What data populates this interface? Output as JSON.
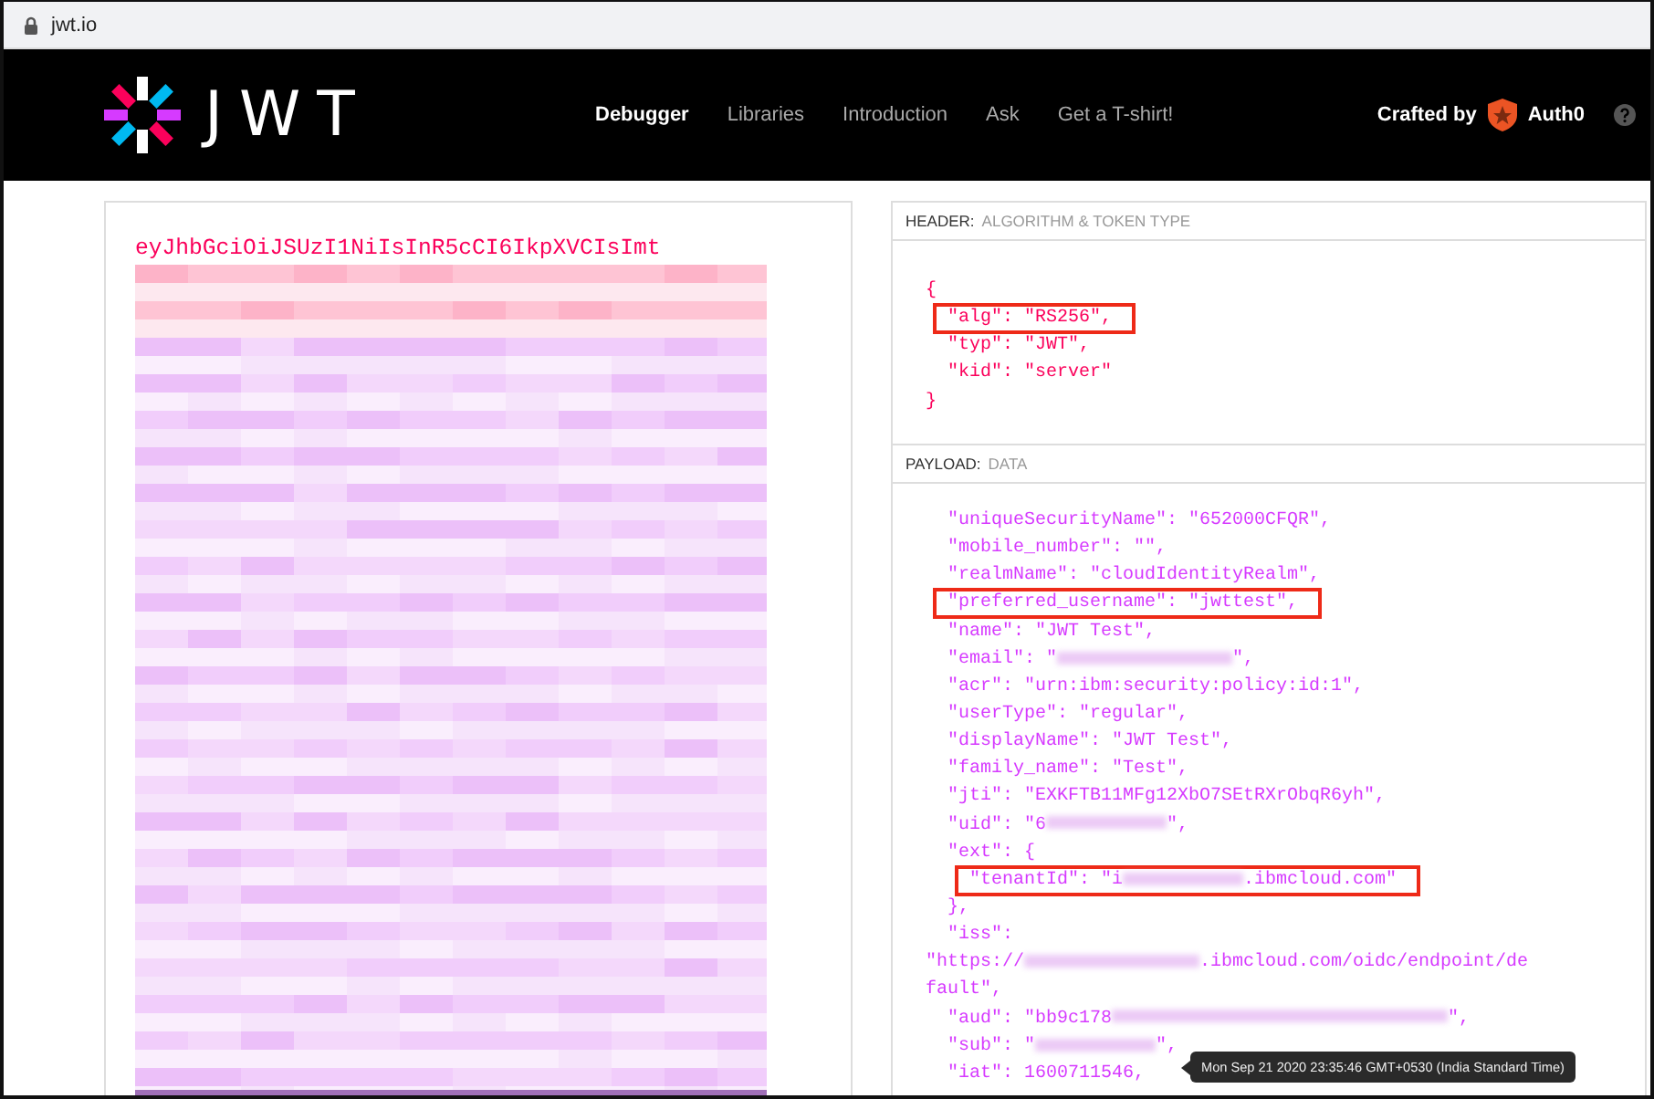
{
  "browser": {
    "url": "jwt.io"
  },
  "nav": {
    "logo_text": "JWT",
    "items": [
      {
        "label": "Debugger",
        "selected": true
      },
      {
        "label": "Libraries",
        "selected": false
      },
      {
        "label": "Introduction",
        "selected": false
      },
      {
        "label": "Ask",
        "selected": false
      },
      {
        "label": "Get a T-shirt!",
        "selected": false
      }
    ],
    "crafted_by": "Crafted by",
    "brand": "Auth0"
  },
  "encoded": {
    "token_start": "eyJhbGciOiJSUzI1NiIsInR5cCI6IkpXVCIsImt"
  },
  "header": {
    "title": "HEADER:",
    "subtitle": "ALGORITHM & TOKEN TYPE",
    "lines": [
      {
        "highlighted": false,
        "segments": [
          {
            "kind": "text",
            "text": "{"
          }
        ],
        "children": [
          {
            "highlighted": true,
            "segments": [
              {
                "kind": "text",
                "text": "\"alg\": \"RS256\","
              }
            ]
          },
          {
            "highlighted": false,
            "segments": [
              {
                "kind": "text",
                "text": "\"typ\": \"JWT\","
              }
            ]
          },
          {
            "highlighted": false,
            "segments": [
              {
                "kind": "text",
                "text": "\"kid\": \"server\""
              }
            ]
          }
        ]
      },
      {
        "highlighted": false,
        "segments": [
          {
            "kind": "text",
            "text": "}"
          }
        ]
      }
    ]
  },
  "payload": {
    "title": "PAYLOAD:",
    "subtitle": "DATA",
    "lines": [
      {
        "highlighted": false,
        "segments": [
          {
            "kind": "text",
            "text": "\"uniqueSecurityName\": \"652000CFQR\","
          }
        ]
      },
      {
        "highlighted": false,
        "segments": [
          {
            "kind": "text",
            "text": "\"mobile_number\": \"\","
          }
        ]
      },
      {
        "highlighted": false,
        "segments": [
          {
            "kind": "text",
            "text": "\"realmName\": \"cloudIdentityRealm\","
          }
        ]
      },
      {
        "highlighted": true,
        "segments": [
          {
            "kind": "text",
            "text": "\"preferred_username\": \"jwttest\","
          }
        ]
      },
      {
        "highlighted": false,
        "segments": [
          {
            "kind": "text",
            "text": "\"name\": \"JWT Test\","
          }
        ]
      },
      {
        "highlighted": false,
        "segments": [
          {
            "kind": "text",
            "text": "\"email\": \""
          },
          {
            "kind": "redacted"
          },
          {
            "kind": "text",
            "text": "\","
          }
        ]
      },
      {
        "highlighted": false,
        "segments": [
          {
            "kind": "text",
            "text": "\"acr\": \"urn:ibm:security:policy:id:1\","
          }
        ]
      },
      {
        "highlighted": false,
        "segments": [
          {
            "kind": "text",
            "text": "\"userType\": \"regular\","
          }
        ]
      },
      {
        "highlighted": false,
        "segments": [
          {
            "kind": "text",
            "text": "\"displayName\": \"JWT Test\","
          }
        ]
      },
      {
        "highlighted": false,
        "segments": [
          {
            "kind": "text",
            "text": "\"family_name\": \"Test\","
          }
        ]
      },
      {
        "highlighted": false,
        "segments": [
          {
            "kind": "text",
            "text": "\"jti\": \"EXKFTB11MFg12XbO7SEtRXrObqR6yh\","
          }
        ]
      },
      {
        "highlighted": false,
        "segments": [
          {
            "kind": "text",
            "text": "\"uid\": \"6"
          },
          {
            "kind": "redacted"
          },
          {
            "kind": "text",
            "text": "\","
          }
        ]
      },
      {
        "highlighted": false,
        "segments": [
          {
            "kind": "text",
            "text": "\"ext\": {"
          }
        ],
        "children": [
          {
            "highlighted": true,
            "segments": [
              {
                "kind": "text",
                "text": "\"tenantId\": \"i"
              },
              {
                "kind": "redacted"
              },
              {
                "kind": "text",
                "text": ".ibmcloud.com\""
              }
            ]
          }
        ]
      },
      {
        "highlighted": false,
        "segments": [
          {
            "kind": "text",
            "text": "},"
          }
        ]
      },
      {
        "highlighted": false,
        "segments": [
          {
            "kind": "text",
            "text": "\"iss\":"
          }
        ]
      },
      {
        "highlighted": false,
        "kind": "wrap",
        "segments": [
          {
            "kind": "text",
            "text": "\"https://"
          },
          {
            "kind": "redacted"
          },
          {
            "kind": "text",
            "text": ".ibmcloud.com/oidc/endpoint/de"
          }
        ]
      },
      {
        "highlighted": false,
        "kind": "wrap",
        "segments": [
          {
            "kind": "text",
            "text": "fault\","
          }
        ]
      },
      {
        "highlighted": false,
        "segments": [
          {
            "kind": "text",
            "text": "\"aud\": \"bb9c178"
          },
          {
            "kind": "redacted"
          },
          {
            "kind": "text",
            "text": "\","
          }
        ]
      },
      {
        "highlighted": false,
        "segments": [
          {
            "kind": "text",
            "text": "\"sub\": \""
          },
          {
            "kind": "redacted"
          },
          {
            "kind": "text",
            "text": "\","
          }
        ]
      },
      {
        "highlighted": false,
        "segments": [
          {
            "kind": "text",
            "text": "\"iat\": 1600711546,"
          }
        ],
        "tooltip": "Mon Sep 21 2020 23:35:46 GMT+0530 (India Standard Time)"
      }
    ]
  }
}
